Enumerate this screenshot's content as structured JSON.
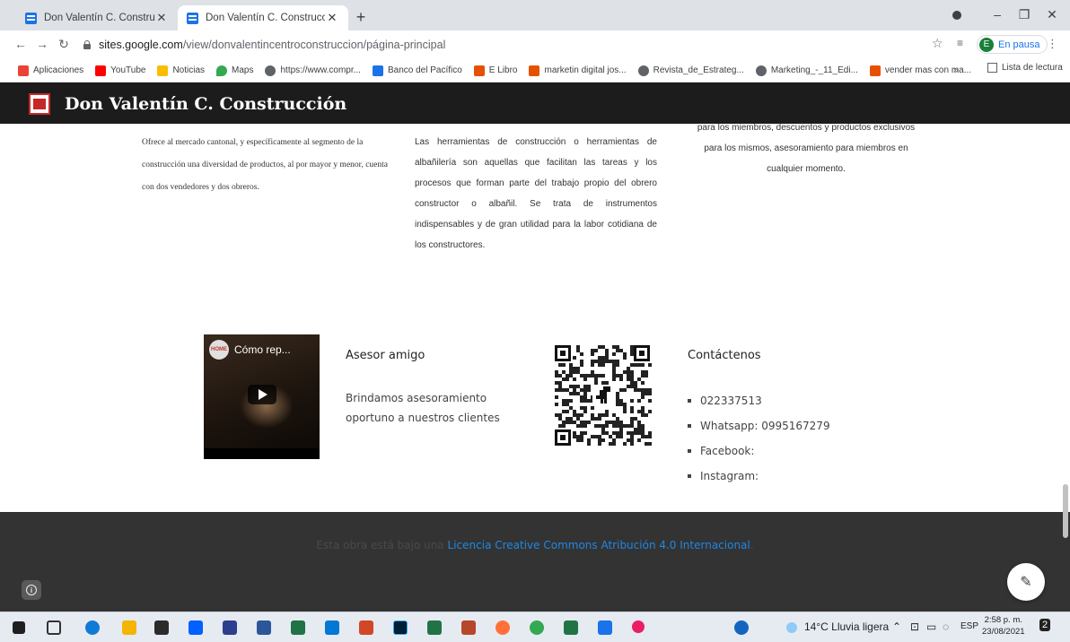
{
  "browser": {
    "tabs": [
      {
        "title": "Don Valentín C. Construcción",
        "active": false
      },
      {
        "title": "Don Valentín C. Construcción",
        "active": true
      }
    ],
    "new_tab": "+",
    "url_host": "sites.google.com",
    "url_path": "/view/donvalentincentroconstruccion/página-principal",
    "profile_initial": "E",
    "profile_status": "En pausa",
    "bookmarks": [
      {
        "label": "Aplicaciones",
        "color": "#ea4335"
      },
      {
        "label": "YouTube",
        "color": "#ff0000"
      },
      {
        "label": "Noticias",
        "color": "#fbbc04"
      },
      {
        "label": "Maps",
        "color": "#34a853"
      },
      {
        "label": "https://www.compr...",
        "color": "#5f6368"
      },
      {
        "label": "Banco del Pacífico",
        "color": "#1a73e8"
      },
      {
        "label": "E Libro",
        "color": "#e65100"
      },
      {
        "label": "marketin digital jos...",
        "color": "#e65100"
      },
      {
        "label": "Revista_de_Estrateg...",
        "color": "#5f6368"
      },
      {
        "label": "Marketing_-_11_Edi...",
        "color": "#5f6368"
      },
      {
        "label": "vender mas con ma...",
        "color": "#e65100"
      }
    ],
    "bookmarks_more": "»",
    "reading_list": "Lista de lectura"
  },
  "site": {
    "title": "Don Valentín C. Construcción",
    "col1": "Ofrece al mercado cantonal, y específicamente al segmento de la construcción una diversidad de productos, al por mayor y menor, cuenta con dos vendedores y dos obreros.",
    "col2": "Las herramientas de construcción o herramientas de albañilería son aquellas que facilitan las tareas y los procesos que forman parte del trabajo propio del obrero constructor o albañil. Se trata de instrumentos indispensables y de gran utilidad para la labor cotidiana de los constructores.",
    "col3": "para los miembros, descuentos y productos exclusivos para los mismos, asesoramiento para miembros en cualquier momento.",
    "video_title": "Cómo rep...",
    "advisor_title": "Asesor amigo",
    "advisor_text": "Brindamos asesoramiento oportuno a nuestros clientes",
    "contact_title": "Contáctenos",
    "contacts": [
      "022337513",
      "Whatsapp: 0995167279",
      "Facebook:",
      "Instagram:"
    ],
    "footer_prefix": "Esta obra está bajo una ",
    "footer_license": "Licencia Creative Commons Atribución 4.0 Internacional",
    "footer_suffix": "."
  },
  "taskbar": {
    "weather": "14°C  Lluvia ligera",
    "lang": "ESP",
    "time": "2:58 p. m.",
    "date": "23/08/2021",
    "notifications": "2"
  },
  "colors": {
    "header_bg": "#1c1c1c",
    "footer_bg": "#333333",
    "link": "#1e88e5",
    "logo_red": "#c62828"
  }
}
